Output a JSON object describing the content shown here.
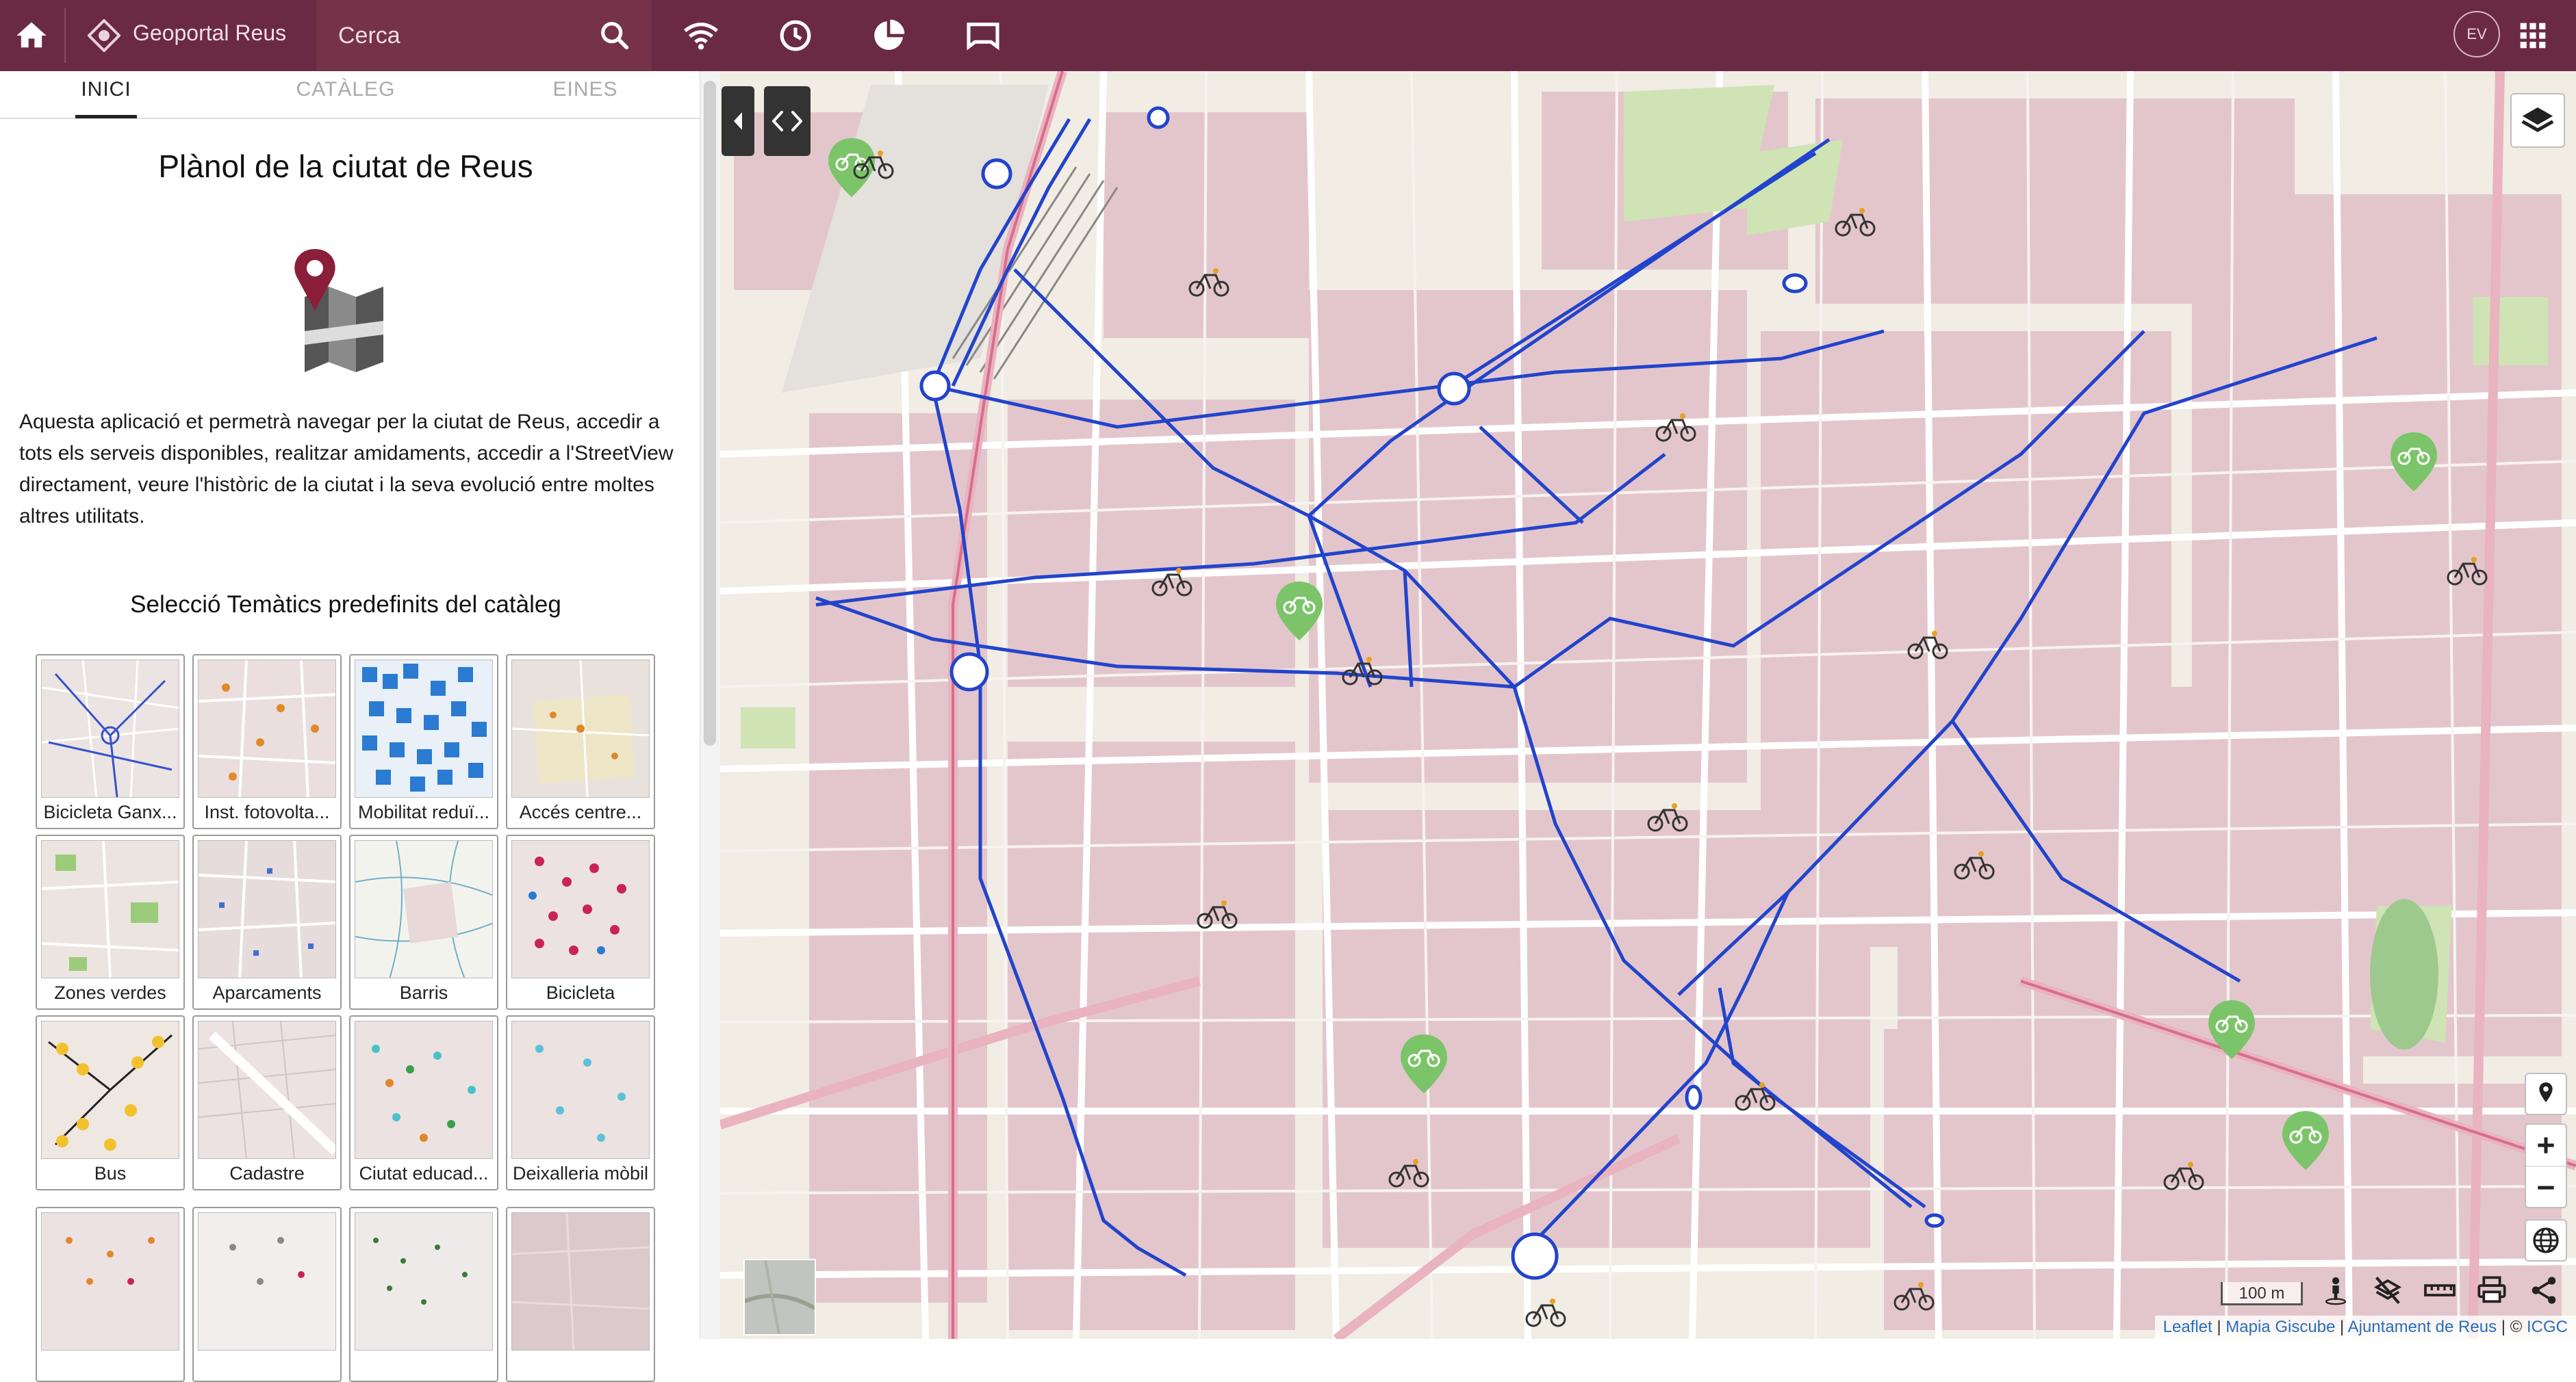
{
  "topbar": {
    "app_title": "Geoportal Reus",
    "search_placeholder": "Cerca",
    "avatar_initials": "EV",
    "icons": [
      "home-icon",
      "logo-icon",
      "search-icon",
      "wifi-icon",
      "history-icon",
      "pie-chart-icon",
      "map-frame-icon",
      "apps-grid-icon"
    ],
    "bar_color": "#6b2a43"
  },
  "tabs": [
    {
      "label": "INICI",
      "active": true
    },
    {
      "label": "CATÀLEG",
      "active": false
    },
    {
      "label": "EINES",
      "active": false
    }
  ],
  "panel": {
    "title": "Plànol de la ciutat de Reus",
    "description": "Aquesta aplicació et permetrà navegar per la ciutat de Reus, accedir a tots els serveis disponibles, realitzar amidaments, accedir a l'StreetView directament, veure l'històric de la ciutat i la seva evolució entre moltes altres utilitats.",
    "subtitle": "Selecció Temàtics predefinits del catàleg",
    "themes": [
      {
        "label": "Bicicleta Ganx..."
      },
      {
        "label": "Inst. fotovolta..."
      },
      {
        "label": "Mobilitat reduï..."
      },
      {
        "label": "Accés centre..."
      },
      {
        "label": "Zones verdes"
      },
      {
        "label": "Aparcaments"
      },
      {
        "label": "Barris"
      },
      {
        "label": "Bicicleta"
      },
      {
        "label": "Bus"
      },
      {
        "label": "Cadastre"
      },
      {
        "label": "Ciutat educad..."
      },
      {
        "label": "Deixalleria mòbil"
      },
      {
        "label": ""
      },
      {
        "label": ""
      },
      {
        "label": ""
      },
      {
        "label": ""
      }
    ]
  },
  "map": {
    "scale_label": "100 m",
    "attribution": {
      "leaflet": "Leaflet",
      "sep1": " | ",
      "mapa": "Mapia Giscube",
      "sep2": " | ",
      "ajuntament": "Ajuntament de Reus",
      "sep3": " | © ",
      "icgc": "ICGC"
    },
    "controls": [
      "layers-icon",
      "location-pin-icon",
      "zoom-in-icon",
      "zoom-out-icon",
      "globe-icon",
      "street-view-icon",
      "layers-off-icon",
      "ruler-icon",
      "print-icon",
      "share-icon"
    ],
    "route_color": "#2244cc",
    "station_color": "#7cc46a"
  }
}
